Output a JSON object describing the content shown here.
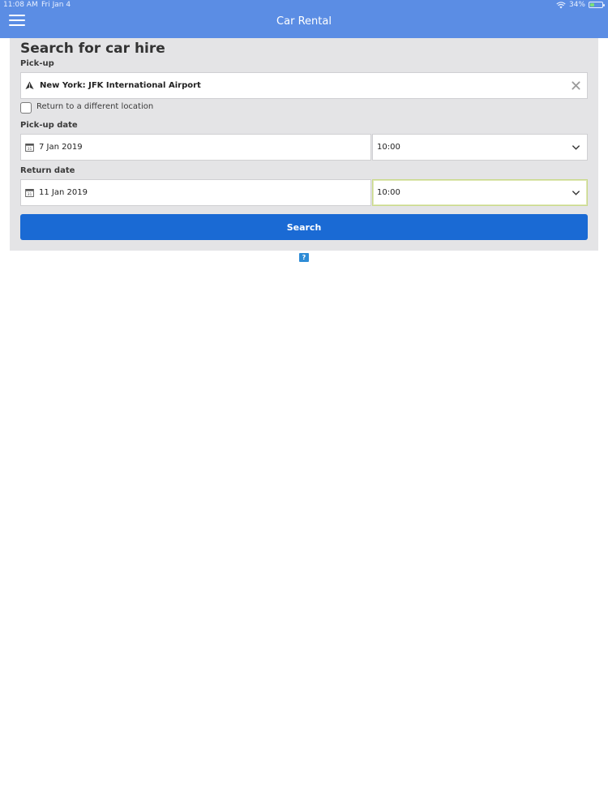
{
  "status_bar": {
    "time": "11:08 AM",
    "date": "Fri Jan 4",
    "battery": "34%",
    "battery_level": 0.34
  },
  "header": {
    "title": "Car Rental",
    "menu_icon": "hamburger-menu-icon"
  },
  "search_form": {
    "title": "Search for car hire",
    "pickup": {
      "label": "Pick-up",
      "value": "New York: JFK International Airport",
      "icon": "airport-icon",
      "clear_icon": "close-icon"
    },
    "different_location": {
      "label": "Return to a different location",
      "checked": false
    },
    "pickup_date": {
      "label": "Pick-up date",
      "date": "7 Jan 2019",
      "time": "10:00"
    },
    "return_date": {
      "label": "Return date",
      "date": "11 Jan 2019",
      "time": "10:00"
    },
    "search_label": "Search"
  },
  "help": {
    "label": "?"
  },
  "colors": {
    "header": "#5b8de4",
    "panel": "#e4e4e6",
    "button": "#1a6ad4"
  }
}
